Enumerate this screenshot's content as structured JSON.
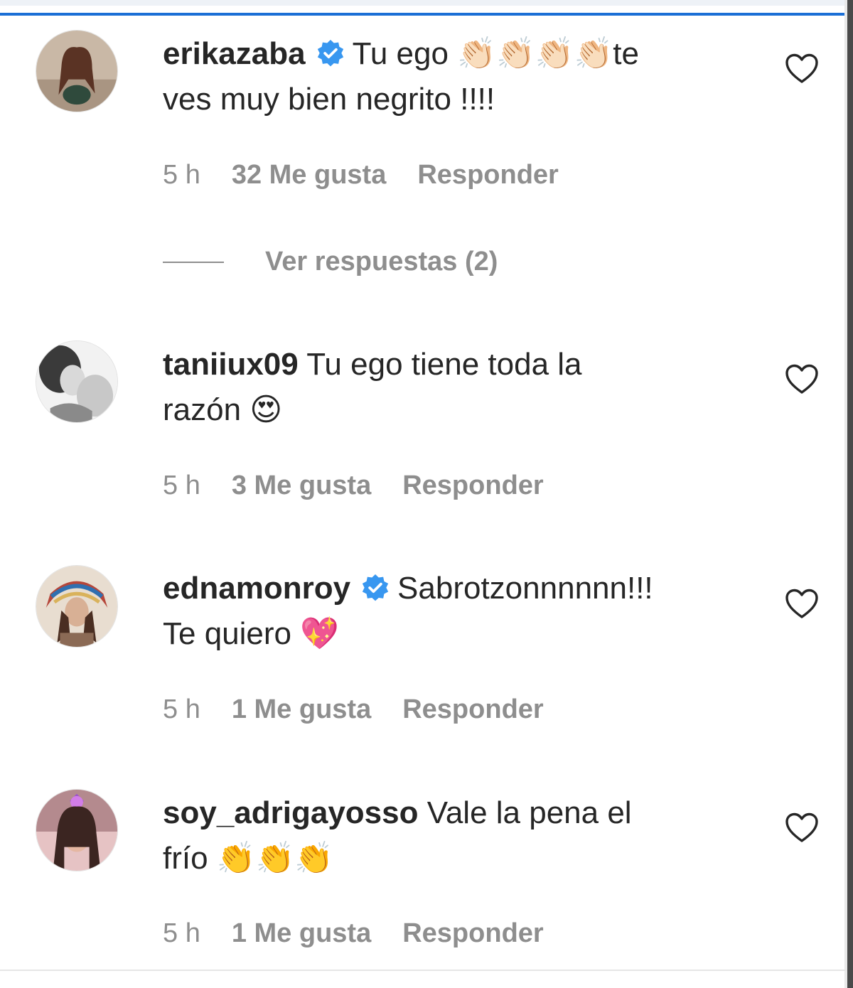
{
  "colors": {
    "text": "#262626",
    "secondary": "#8e8e8e",
    "verified": "#3897f0",
    "accent_bar": "#1b6fd6"
  },
  "comments": [
    {
      "username": "erikazaba",
      "verified": true,
      "text": "Tu ego 👏🏻👏🏻👏🏻👏🏻te",
      "text_line2": "ves muy bien negrito !!!!",
      "time": "5 h",
      "likes": "32 Me gusta",
      "reply": "Responder",
      "view_replies": "Ver respuestas (2)",
      "like_icon": "heart-outline-icon"
    },
    {
      "username": "taniiux09",
      "verified": false,
      "text": "Tu ego tiene toda la",
      "text_line2": "razón 😍",
      "time": "5 h",
      "likes": "3 Me gusta",
      "reply": "Responder",
      "like_icon": "heart-outline-icon"
    },
    {
      "username": "ednamonroy",
      "verified": true,
      "text": "Sabrotzonnnnnn!!!",
      "text_line2": "Te quiero 💖",
      "time": "5 h",
      "likes": "1 Me gusta",
      "reply": "Responder",
      "like_icon": "heart-outline-icon"
    },
    {
      "username": "soy_adrigayosso",
      "verified": false,
      "text": "Vale la pena el",
      "text_line2": "frío 👏👏👏",
      "time": "5 h",
      "likes": "1 Me gusta",
      "reply": "Responder",
      "like_icon": "heart-outline-icon"
    }
  ]
}
